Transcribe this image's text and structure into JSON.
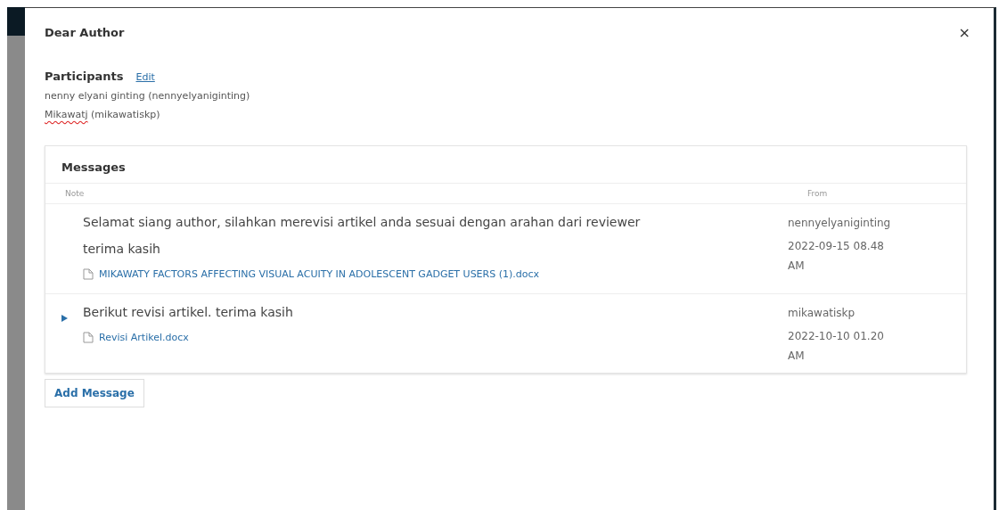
{
  "modal": {
    "title": "Dear Author",
    "close": "×"
  },
  "participants": {
    "heading": "Participants",
    "edit": "Edit",
    "people": [
      {
        "name": "nenny elyani ginting",
        "username": "(nennyelyaniginting)",
        "spellcheck_flag": false
      },
      {
        "name": "Mikawatj",
        "username": "(mikawatiskp)",
        "spellcheck_flag": true
      }
    ]
  },
  "messages": {
    "heading": "Messages",
    "columns": [
      "Note",
      "From"
    ],
    "rows": [
      {
        "unread": false,
        "paragraphs": [
          "Selamat siang author, silahkan merevisi artikel anda sesuai dengan arahan dari reviewer",
          "terima kasih"
        ],
        "files": [
          "MIKAWATY FACTORS AFFECTING VISUAL ACUITY IN ADOLESCENT GADGET USERS (1).docx"
        ],
        "from": "nennyelyaniginting",
        "date": "2022-09-15 08.48 AM"
      },
      {
        "unread": true,
        "paragraphs": [
          "Berikut revisi artikel. terima kasih"
        ],
        "files": [
          "Revisi Artikel.docx"
        ],
        "from": "mikawatiskp",
        "date": "2022-10-10 01.20 AM"
      }
    ]
  },
  "add_button": "Add Message"
}
